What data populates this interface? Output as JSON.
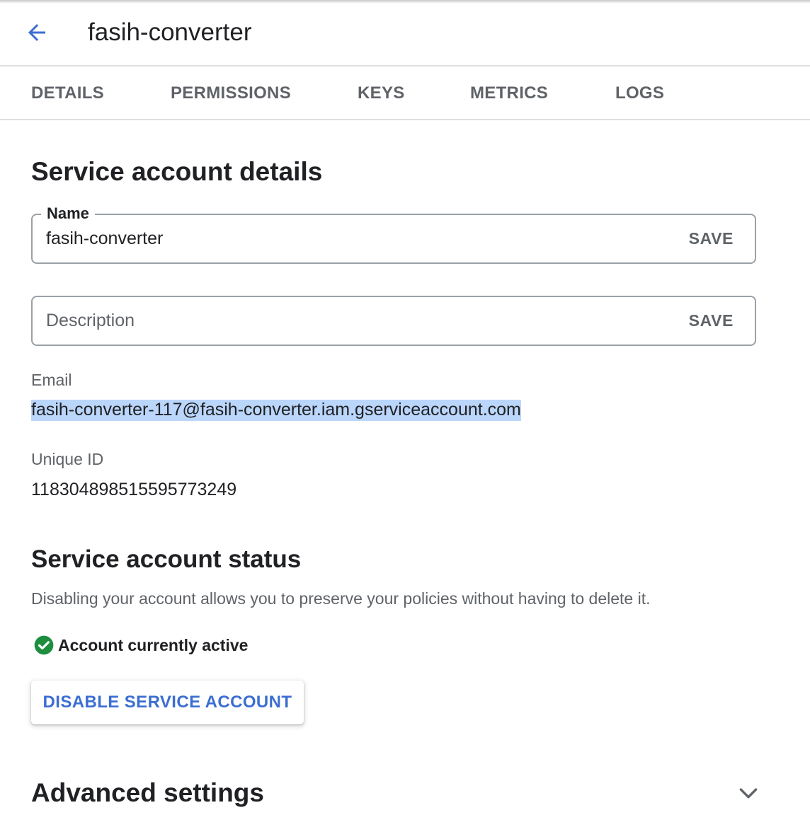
{
  "header": {
    "title": "fasih-converter",
    "back_icon": "arrow-back-icon"
  },
  "tabs": [
    {
      "label": "DETAILS"
    },
    {
      "label": "PERMISSIONS"
    },
    {
      "label": "KEYS"
    },
    {
      "label": "METRICS"
    },
    {
      "label": "LOGS"
    }
  ],
  "details": {
    "title": "Service account details",
    "name_field": {
      "label": "Name",
      "value": "fasih-converter",
      "save_label": "SAVE"
    },
    "description_field": {
      "placeholder": "Description",
      "save_label": "SAVE"
    },
    "email": {
      "label": "Email",
      "value": "fasih-converter-117@fasih-converter.iam.gserviceaccount.com"
    },
    "unique_id": {
      "label": "Unique ID",
      "value": "118304898515595773249"
    }
  },
  "status": {
    "title": "Service account status",
    "help_text": "Disabling your account allows you to preserve your policies without having to delete it.",
    "state_text": "Account currently active",
    "state_icon": "check-circle-icon",
    "disable_button": "DISABLE SERVICE ACCOUNT"
  },
  "advanced": {
    "title": "Advanced settings",
    "expand_icon": "chevron-down-icon"
  },
  "colors": {
    "accent": "#3c6ed1",
    "selection": "#bbd6fb",
    "success": "#1e8e3e",
    "secondary_text": "#5f6368"
  }
}
